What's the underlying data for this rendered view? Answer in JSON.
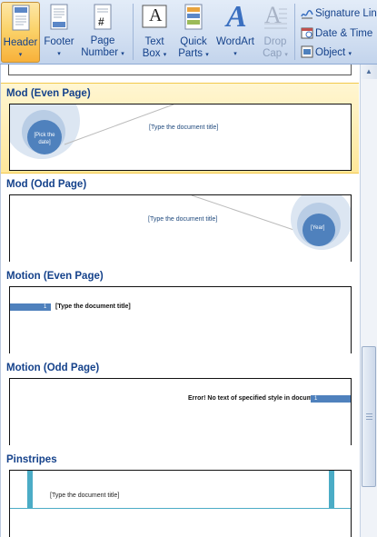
{
  "ribbon": {
    "header": {
      "label": "Header"
    },
    "footer": {
      "label": "Footer"
    },
    "page_number": {
      "label_line1": "Page",
      "label_line2": "Number"
    },
    "text_box": {
      "label_line1": "Text",
      "label_line2": "Box"
    },
    "quick_parts": {
      "label_line1": "Quick",
      "label_line2": "Parts"
    },
    "wordart": {
      "label": "WordArt"
    },
    "drop_cap": {
      "label_line1": "Drop",
      "label_line2": "Cap"
    },
    "signature_line": {
      "label": "Signature Lin"
    },
    "date_time": {
      "label": "Date & Time"
    },
    "object": {
      "label": "Object"
    },
    "caret": "▾",
    "page_number_glyph": "#",
    "text_box_glyph": "A",
    "wordart_glyph": "A",
    "drop_cap_glyph": "A"
  },
  "gallery": {
    "entries": [
      {
        "title": "Mod (Even Page)",
        "selected": true,
        "placeholder": "[Type the document title]",
        "circle_text": "[Pick the date]"
      },
      {
        "title": "Mod (Odd Page)",
        "selected": false,
        "placeholder": "[Type the document title]",
        "circle_text": "[Year]"
      },
      {
        "title": "Motion (Even Page)",
        "selected": false,
        "placeholder": "[Type the document title]",
        "page_num": "1"
      },
      {
        "title": "Motion (Odd Page)",
        "selected": false,
        "placeholder": "Error! No text of specified style in document.",
        "page_num": "1"
      },
      {
        "title": "Pinstripes",
        "selected": false,
        "placeholder": "[Type the document title]"
      }
    ]
  },
  "scrollbar": {
    "up_arrow": "▲"
  },
  "colors": {
    "accent_blue": "#4f81bd",
    "ribbon_text": "#15428b",
    "selection": "#ffe79a",
    "pinstripe_teal": "#4bacc6"
  }
}
